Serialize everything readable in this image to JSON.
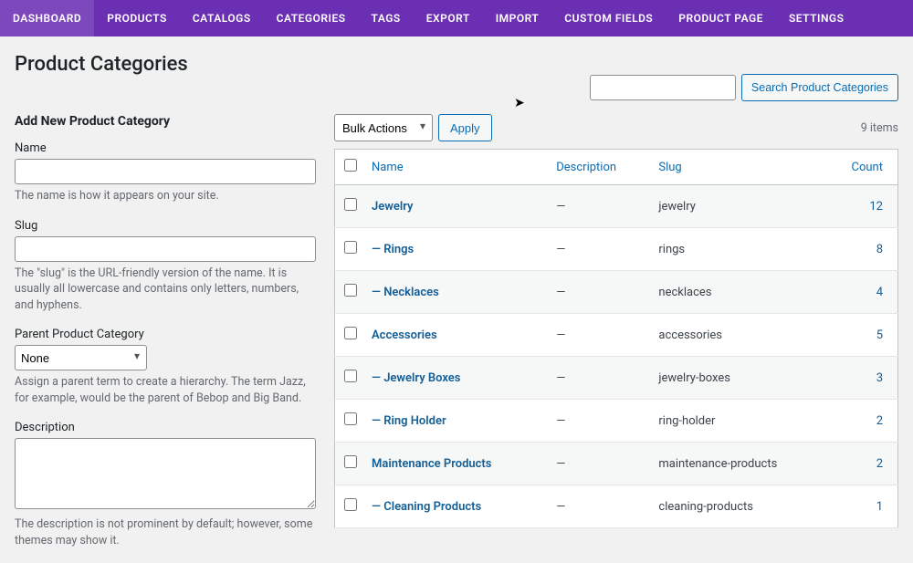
{
  "nav": {
    "items": [
      "DASHBOARD",
      "PRODUCTS",
      "CATALOGS",
      "CATEGORIES",
      "TAGS",
      "EXPORT",
      "IMPORT",
      "CUSTOM FIELDS",
      "PRODUCT PAGE",
      "SETTINGS"
    ]
  },
  "page": {
    "title": "Product Categories"
  },
  "search": {
    "button": "Search Product Categories"
  },
  "form": {
    "heading": "Add New Product Category",
    "name_label": "Name",
    "name_help": "The name is how it appears on your site.",
    "slug_label": "Slug",
    "slug_help": "The \"slug\" is the URL-friendly version of the name. It is usually all lowercase and contains only letters, numbers, and hyphens.",
    "parent_label": "Parent Product Category",
    "parent_selected": "None",
    "parent_help": "Assign a parent term to create a hierarchy. The term Jazz, for example, would be the parent of Bebop and Big Band.",
    "desc_label": "Description",
    "desc_help": "The description is not prominent by default; however, some themes may show it."
  },
  "tablenav": {
    "bulk_label": "Bulk Actions",
    "apply": "Apply",
    "items_count": "9 items"
  },
  "table": {
    "headers": {
      "name": "Name",
      "description": "Description",
      "slug": "Slug",
      "count": "Count"
    },
    "rows": [
      {
        "name": "Jewelry",
        "desc": "—",
        "slug": "jewelry",
        "count": "12",
        "indent": 0
      },
      {
        "name": "Rings",
        "desc": "—",
        "slug": "rings",
        "count": "8",
        "indent": 1
      },
      {
        "name": "Necklaces",
        "desc": "—",
        "slug": "necklaces",
        "count": "4",
        "indent": 1
      },
      {
        "name": "Accessories",
        "desc": "—",
        "slug": "accessories",
        "count": "5",
        "indent": 0
      },
      {
        "name": "Jewelry Boxes",
        "desc": "—",
        "slug": "jewelry-boxes",
        "count": "3",
        "indent": 1
      },
      {
        "name": "Ring Holder",
        "desc": "—",
        "slug": "ring-holder",
        "count": "2",
        "indent": 1
      },
      {
        "name": "Maintenance Products",
        "desc": "—",
        "slug": "maintenance-products",
        "count": "2",
        "indent": 0
      },
      {
        "name": "Cleaning Products",
        "desc": "—",
        "slug": "cleaning-products",
        "count": "1",
        "indent": 1
      }
    ]
  }
}
